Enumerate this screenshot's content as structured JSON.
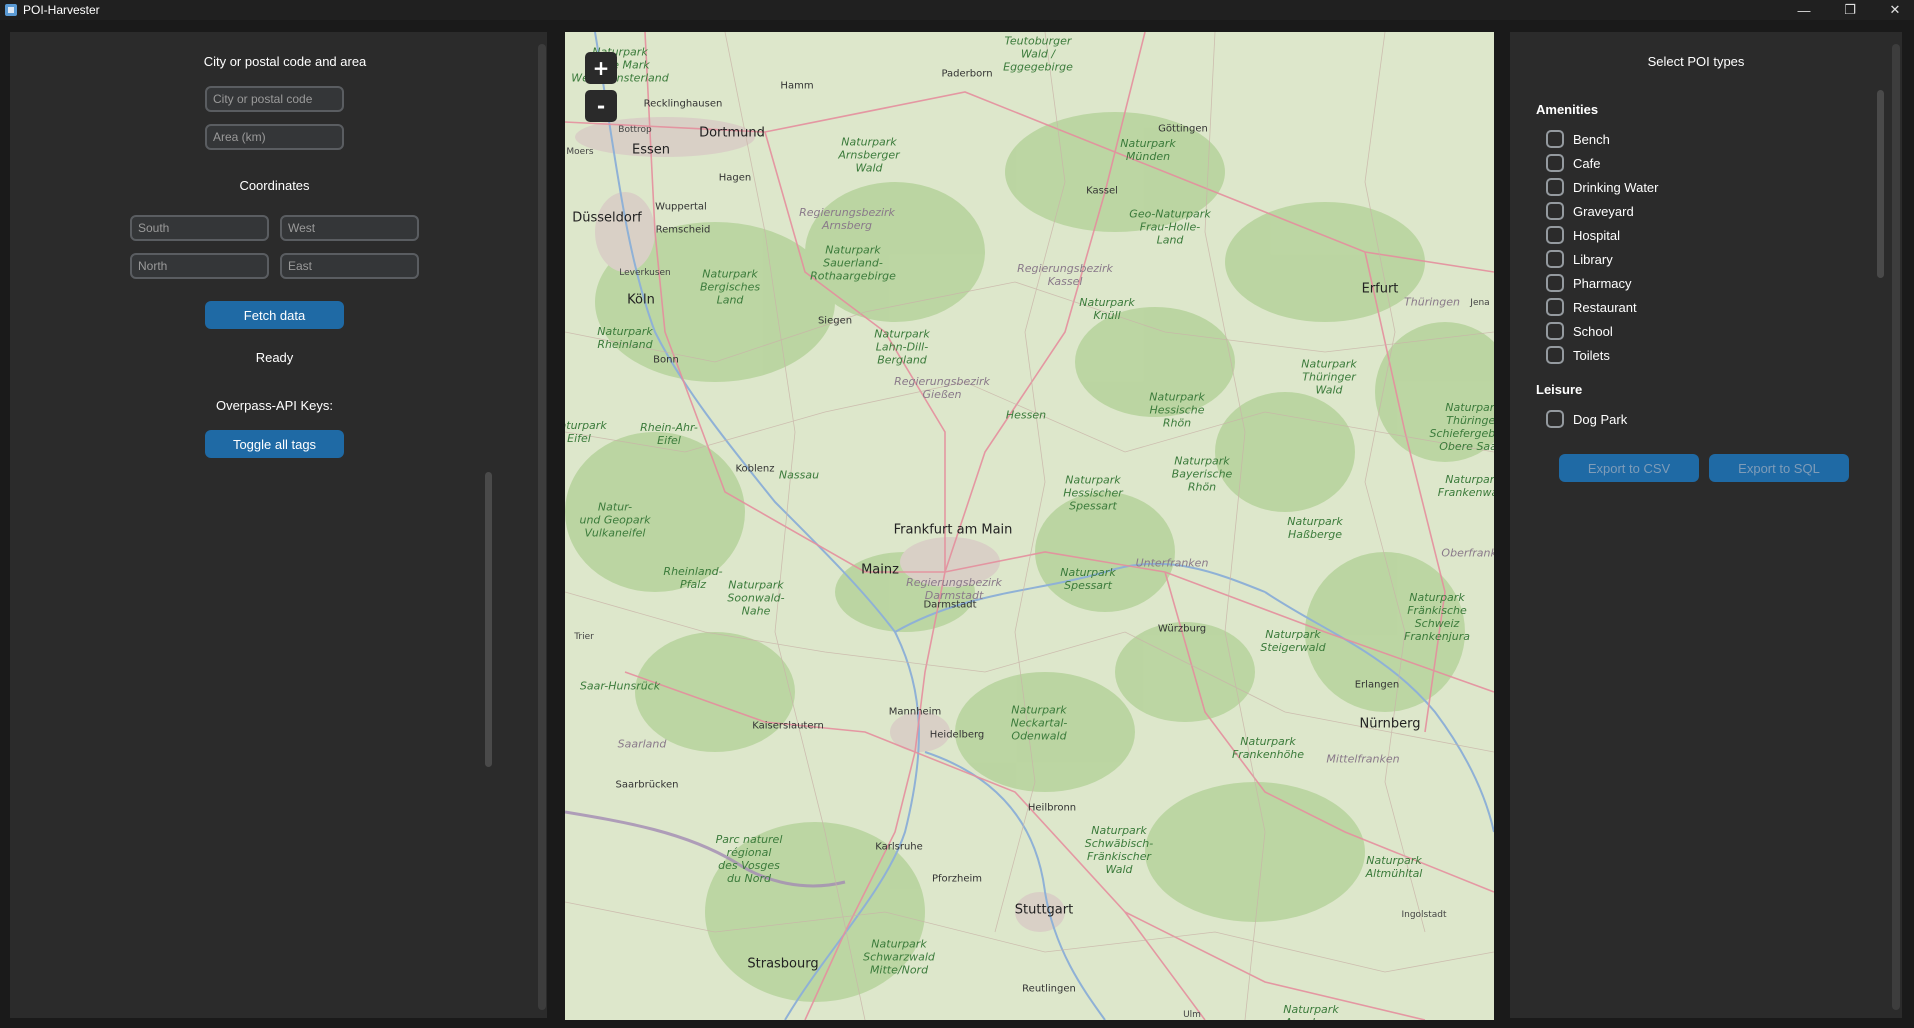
{
  "window": {
    "title": "POI-Harvester",
    "controls": [
      "minimize",
      "restore",
      "close"
    ]
  },
  "left_panel": {
    "city_area_label": "City or postal code and area",
    "city_placeholder": "City or postal code",
    "area_placeholder": "Area (km)",
    "coordinates_label": "Coordinates",
    "south_placeholder": "South",
    "west_placeholder": "West",
    "north_placeholder": "North",
    "east_placeholder": "East",
    "fetch_button": "Fetch data",
    "status": "Ready",
    "api_keys_label": "Overpass-API Keys:",
    "toggle_button": "Toggle all tags"
  },
  "map": {
    "zoom_in": "+",
    "zoom_out": "-",
    "big_cities": [
      "Dortmund",
      "Essen",
      "Düsseldorf",
      "Köln",
      "Frankfurt am Main",
      "Mainz",
      "Erfurt",
      "Nürnberg",
      "Stuttgart",
      "Strasbourg"
    ],
    "cities": [
      "Paderborn",
      "Hamm",
      "Recklinghausen",
      "Bottrop",
      "Moers",
      "Hagen",
      "Wuppertal",
      "Remscheid",
      "Leverkusen",
      "Siegen",
      "Bonn",
      "Koblenz",
      "Kassel",
      "Göttingen",
      "Darmstadt",
      "Würzburg",
      "Erlangen",
      "Trier",
      "Saarbrücken",
      "Kaiserslautern",
      "Mannheim",
      "Heidelberg",
      "Heilbronn",
      "Karlsruhe",
      "Pforzheim",
      "Reutlingen",
      "Ingolstadt",
      "Ulm",
      "Jena"
    ],
    "regions": [
      "Teutoburger\nWald /\nEggegebirge",
      "Naturpark\nHohe Mark\nWestmünsterland",
      "Naturpark\nArnsberger\nWald",
      "Regierungsbezirk\nArnsberg",
      "Naturpark\nSauerland-\nRothaargebirge",
      "Naturpark\nBergisches\nLand",
      "Naturpark\nRheinland",
      "Naturpark\nMünden",
      "Geo-Naturpark\nFrau-Holle-\nLand",
      "Regierungsbezirk\nKassel",
      "Naturpark\nKnüll",
      "Thüringen",
      "Naturpark\nThüringer\nWald",
      "Naturpark\nLahn-Dill-\nBergland",
      "Regierungsbezirk\nGießen",
      "Hessen",
      "Naturpark\nHessische\nRhön",
      "Naturpark\nBayerische\nRhön",
      "Rhein-Ahr-\nEifel",
      "Nassau",
      "Naturpark\nHessischer\nSpessart",
      "Natur-\nund Geopark\nVulkaneifel",
      "Regierungsbezirk\nDarmstadt",
      "Naturpark\nSpessart",
      "Unterfranken",
      "Naturpark\nHaßberge",
      "Oberfranken",
      "Rheinland-\nPfalz",
      "Naturpark\nSoonwald-\nNahe",
      "Naturpark\nSteigerwald",
      "Naturpark\nFränkische\nSchweiz\nFrankenjura",
      "Saar-Hunsrück",
      "Saarland",
      "Naturpark\nNeckartal-\nOdenwald",
      "Naturpark\nFrankenhöhe",
      "Mittelfranken",
      "Parc naturel\nrégional\ndes Vosges\ndu Nord",
      "Naturpark\nSchwäbisch-\nFränkischer\nWald",
      "Naturpark\nAltmühltal",
      "Naturpark\nSchwarzwald\nMitte/Nord",
      "Naturpark\nEifel",
      "Naturpark\nThüringer\nSchiefergebirge\nObere Saale",
      "Naturpark\nFrankenwald",
      "Naturpark\nAugsburg"
    ]
  },
  "right_panel": {
    "title": "Select POI types",
    "amenities_label": "Amenities",
    "amenities": [
      "Bench",
      "Cafe",
      "Drinking Water",
      "Graveyard",
      "Hospital",
      "Library",
      "Pharmacy",
      "Restaurant",
      "School",
      "Toilets"
    ],
    "leisure_label": "Leisure",
    "leisure": [
      "Dog Park"
    ],
    "export_csv": "Export to CSV",
    "export_sql": "Export to SQL"
  }
}
